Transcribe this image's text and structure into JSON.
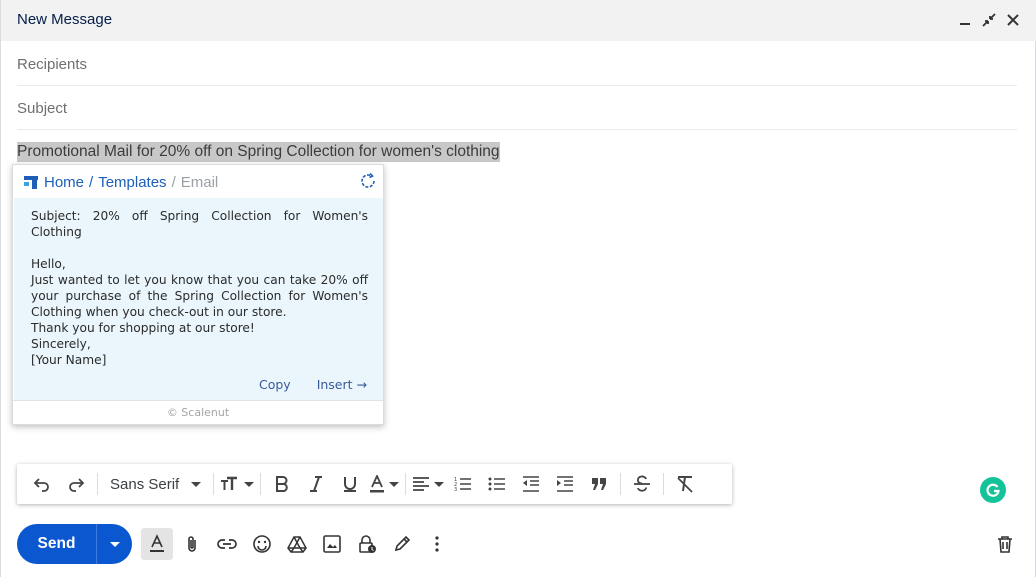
{
  "header": {
    "title": "New Message"
  },
  "fields": {
    "recipients_placeholder": "Recipients",
    "subject_placeholder": "Subject"
  },
  "body": {
    "text": "Promotional Mail for 20% off on Spring Collection for women's clothing"
  },
  "popup": {
    "breadcrumb": {
      "home": "Home",
      "sep1": "/",
      "templates": "Templates",
      "sep2": "/",
      "current": "Email"
    },
    "template_text": "Subject: 20% off Spring Collection for Women's Clothing\n\nHello,\nJust wanted to let you know that you can take 20% off your purchase of the Spring Collection for Women's Clothing when you check-out in our store.\nThank you for shopping at our store!\nSincerely,\n[Your Name]",
    "copy_label": "Copy",
    "insert_label": "Insert →",
    "footer": "© Scalenut"
  },
  "toolbar": {
    "font": "Sans Serif"
  },
  "bottom": {
    "send_label": "Send"
  },
  "colors": {
    "send": "#0b57d0",
    "grammarly": "#15c39a",
    "link": "#1d5fb8"
  }
}
